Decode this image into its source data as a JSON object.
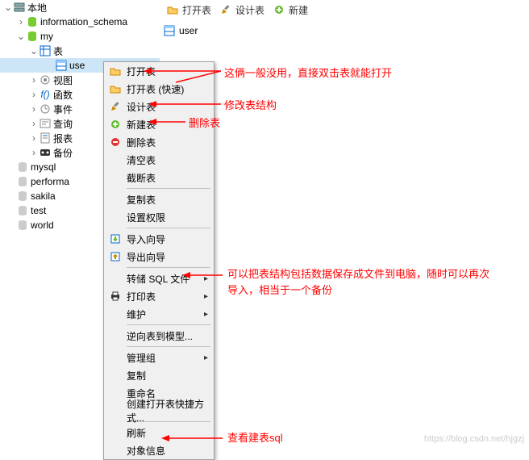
{
  "tree": {
    "root": "本地",
    "items": [
      "information_schema",
      "my",
      "表",
      "use",
      "视图",
      "函数",
      "事件",
      "查询",
      "报表",
      "备份",
      "mysql",
      "performa",
      "sakila",
      "test",
      "world"
    ]
  },
  "toolbar": {
    "open": "打开表",
    "design": "设计表",
    "new": "新建"
  },
  "content": {
    "user": "user"
  },
  "menu": {
    "open_table": "打开表",
    "open_fast": "打开表 (快速)",
    "design_table": "设计表",
    "new_table": "新建表",
    "delete_table": "删除表",
    "clear_table": "清空表",
    "truncate_table": "截断表",
    "copy_table": "复制表",
    "set_perm": "设置权限",
    "import_wiz": "导入向导",
    "export_wiz": "导出向导",
    "dump_sql": "转储 SQL 文件",
    "print_table": "打印表",
    "maintain": "维护",
    "reverse_model": "逆向表到模型...",
    "manage_group": "管理组",
    "copy": "复制",
    "rename": "重命名",
    "create_shortcut": "创建打开表快捷方式...",
    "refresh": "刷新",
    "object_info": "对象信息"
  },
  "annotations": {
    "a1": "这俩一般没用，直接双击表就能打开",
    "a2": "修改表结构",
    "a3": "删除表",
    "a4": "可以把表结构包括数据保存成文件到电脑，随时可以再次导入，相当于一个备份",
    "a5": "查看建表sql"
  },
  "watermark": "https://blog.csdn.net/hjgzj"
}
